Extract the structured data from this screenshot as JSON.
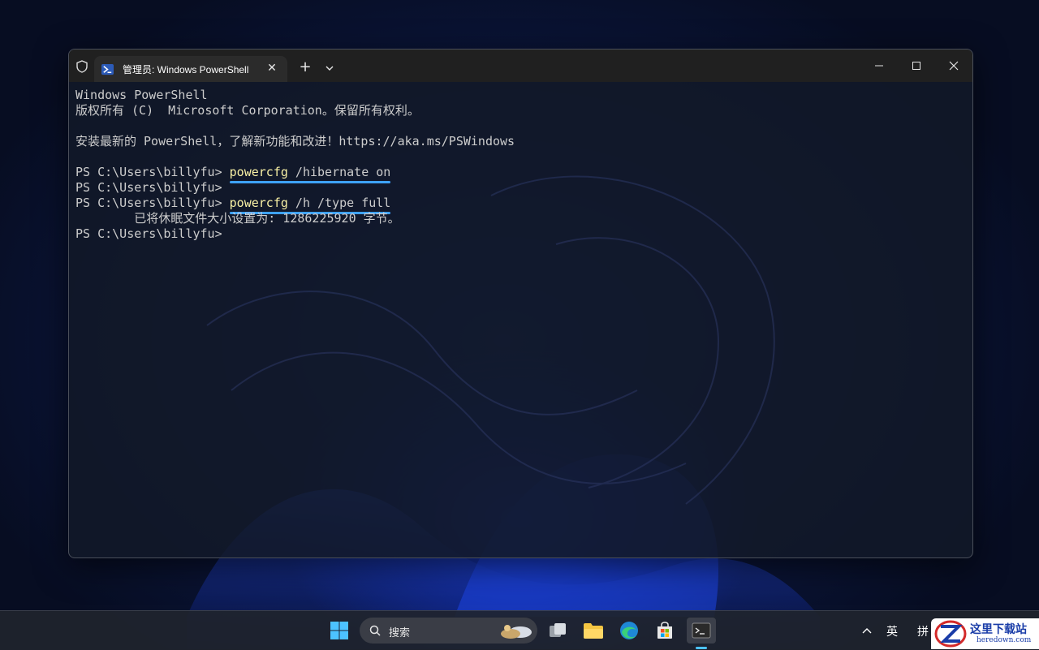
{
  "window": {
    "tab_title": "管理员: Windows PowerShell",
    "new_tab_symbol": "+",
    "close_tab_symbol": "✕"
  },
  "console": {
    "lines": [
      {
        "text": "Windows PowerShell"
      },
      {
        "text": "版权所有 (C)  Microsoft Corporation。保留所有权利。"
      },
      {
        "text": ""
      },
      {
        "text": "安装最新的 PowerShell，了解新功能和改进！https://aka.ms/PSWindows"
      },
      {
        "text": ""
      },
      {
        "prompt": "PS C:\\Users\\billyfu> ",
        "cmd": "powercfg",
        "args": " /hibernate on",
        "underlined": true
      },
      {
        "prompt": "PS C:\\Users\\billyfu>"
      },
      {
        "prompt": "PS C:\\Users\\billyfu> ",
        "cmd": "powercfg",
        "args": " /h /type full",
        "underlined": true
      },
      {
        "text": "        已将休眠文件大小设置为: 1286225920 字节。"
      },
      {
        "prompt": "PS C:\\Users\\billyfu>"
      }
    ]
  },
  "taskbar": {
    "search_label": "搜索",
    "tray_lang": "英",
    "tray_ime": "拼"
  },
  "watermark": {
    "title": "这里下载站",
    "subtitle": "heredown.com"
  },
  "colors": {
    "command": "#f9f1a5",
    "underline": "#3ea2ff",
    "console_text": "#cccccc"
  }
}
